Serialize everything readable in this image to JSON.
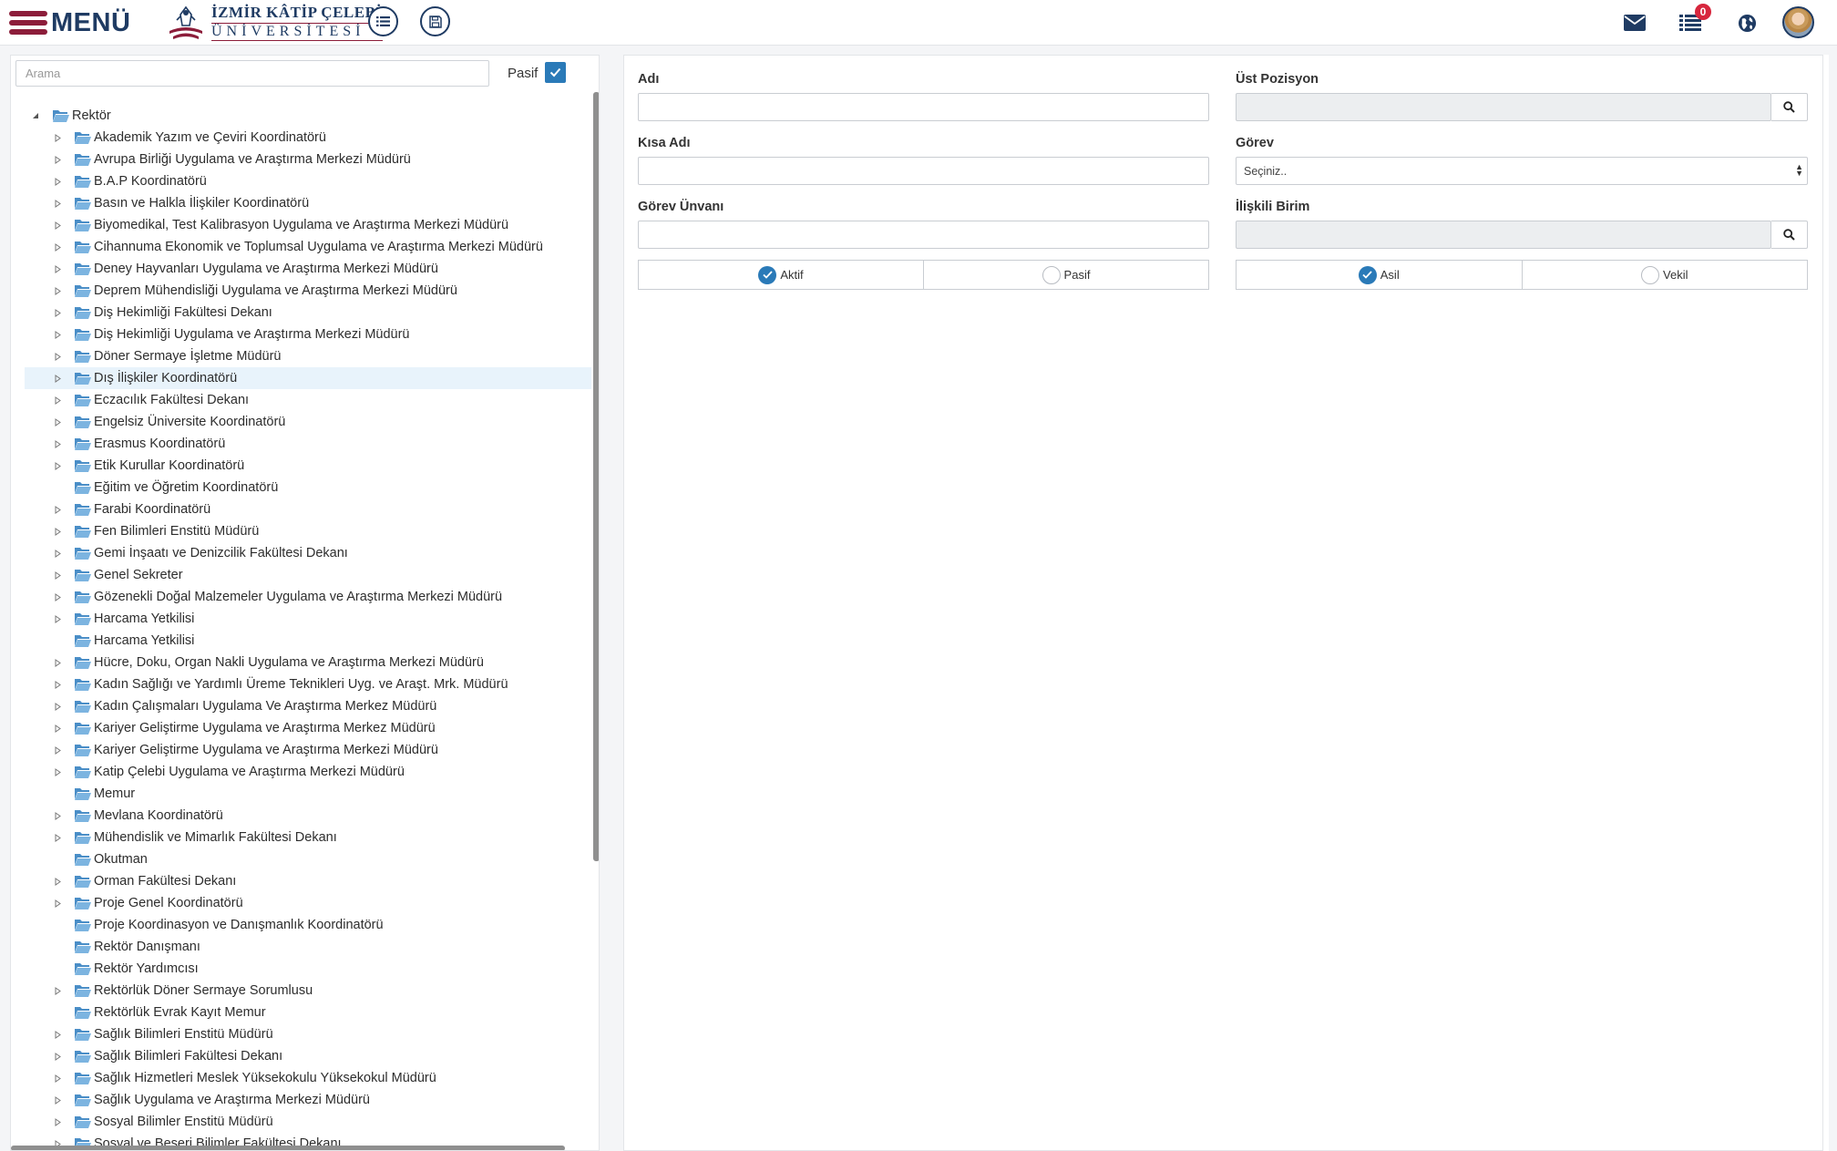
{
  "header": {
    "menu_label": "MENÜ",
    "logo_line1": "İZMİR KÂTİP ÇELEBİ",
    "logo_line2": "ÜNİVERSİTESİ",
    "list_button_icon": "list-icon",
    "save_button_icon": "save-icon",
    "mail_icon": "envelope-icon",
    "tasks_icon": "tasks-list-icon",
    "tasks_badge": "0",
    "language_icon": "globe-icon",
    "accent_color": "#1f3b63",
    "brand_color": "#8c1d3a"
  },
  "left": {
    "search": {
      "placeholder": "Arama",
      "value": ""
    },
    "pasif_label": "Pasif",
    "pasif_checked": true,
    "tree_root": "Rektör",
    "selected_index": 11,
    "items": [
      {
        "label": "Akademik Yazım ve Çeviri Koordinatörü",
        "expandable": true
      },
      {
        "label": "Avrupa Birliği Uygulama ve Araştırma Merkezi Müdürü",
        "expandable": true
      },
      {
        "label": "B.A.P Koordinatörü",
        "expandable": true
      },
      {
        "label": "Basın ve Halkla İlişkiler Koordinatörü",
        "expandable": true
      },
      {
        "label": "Biyomedikal, Test Kalibrasyon Uygulama ve Araştırma Merkezi Müdürü",
        "expandable": true
      },
      {
        "label": "Cihannuma Ekonomik ve Toplumsal Uygulama ve Araştırma Merkezi Müdürü",
        "expandable": true
      },
      {
        "label": "Deney Hayvanları Uygulama ve Araştırma Merkezi Müdürü",
        "expandable": true
      },
      {
        "label": "Deprem Mühendisliği Uygulama ve Araştırma Merkezi Müdürü",
        "expandable": true
      },
      {
        "label": "Diş Hekimliği Fakültesi Dekanı",
        "expandable": true
      },
      {
        "label": "Diş Hekimliği Uygulama ve Araştırma Merkezi Müdürü",
        "expandable": true
      },
      {
        "label": "Döner Sermaye İşletme Müdürü",
        "expandable": true
      },
      {
        "label": "Dış İlişkiler Koordinatörü",
        "expandable": true
      },
      {
        "label": "Eczacılık Fakültesi Dekanı",
        "expandable": true
      },
      {
        "label": "Engelsiz Üniversite Koordinatörü",
        "expandable": true
      },
      {
        "label": "Erasmus Koordinatörü",
        "expandable": true
      },
      {
        "label": "Etik Kurullar Koordinatörü",
        "expandable": true
      },
      {
        "label": "Eğitim ve Öğretim Koordinatörü",
        "expandable": false
      },
      {
        "label": "Farabi Koordinatörü",
        "expandable": true
      },
      {
        "label": "Fen Bilimleri Enstitü Müdürü",
        "expandable": true
      },
      {
        "label": "Gemi İnşaatı ve Denizcilik Fakültesi Dekanı",
        "expandable": true
      },
      {
        "label": "Genel Sekreter",
        "expandable": true
      },
      {
        "label": "Gözenekli Doğal Malzemeler Uygulama ve Araştırma Merkezi Müdürü",
        "expandable": true
      },
      {
        "label": "Harcama Yetkilisi",
        "expandable": true
      },
      {
        "label": "Harcama Yetkilisi",
        "expandable": false
      },
      {
        "label": "Hücre, Doku, Organ Nakli Uygulama ve Araştırma Merkezi Müdürü",
        "expandable": true
      },
      {
        "label": "Kadın Sağlığı ve Yardımlı Üreme Teknikleri Uyg. ve Araşt. Mrk. Müdürü",
        "expandable": true
      },
      {
        "label": "Kadın Çalışmaları Uygulama Ve Araştırma Merkez Müdürü",
        "expandable": true
      },
      {
        "label": "Kariyer Geliştirme Uygulama ve Araştırma Merkez Müdürü",
        "expandable": true
      },
      {
        "label": "Kariyer Geliştirme Uygulama ve Araştırma Merkezi Müdürü",
        "expandable": true
      },
      {
        "label": "Katip Çelebi Uygulama ve Araştırma Merkezi Müdürü",
        "expandable": true
      },
      {
        "label": "Memur",
        "expandable": false
      },
      {
        "label": "Mevlana Koordinatörü",
        "expandable": true
      },
      {
        "label": "Mühendislik ve Mimarlık Fakültesi Dekanı",
        "expandable": true
      },
      {
        "label": "Okutman",
        "expandable": false
      },
      {
        "label": "Orman Fakültesi Dekanı",
        "expandable": true
      },
      {
        "label": "Proje Genel Koordinatörü",
        "expandable": true
      },
      {
        "label": "Proje Koordinasyon ve Danışmanlık Koordinatörü",
        "expandable": false
      },
      {
        "label": "Rektör Danışmanı",
        "expandable": false
      },
      {
        "label": "Rektör Yardımcısı",
        "expandable": false
      },
      {
        "label": "Rektörlük Döner Sermaye Sorumlusu",
        "expandable": true
      },
      {
        "label": "Rektörlük Evrak Kayıt Memur",
        "expandable": false
      },
      {
        "label": "Sağlık Bilimleri Enstitü Müdürü",
        "expandable": true
      },
      {
        "label": "Sağlık Bilimleri Fakültesi Dekanı",
        "expandable": true
      },
      {
        "label": "Sağlık Hizmetleri Meslek Yüksekokulu Yüksekokul Müdürü",
        "expandable": true
      },
      {
        "label": "Sağlık Uygulama ve Araştırma Merkezi Müdürü",
        "expandable": true
      },
      {
        "label": "Sosyal Bilimler Enstitü Müdürü",
        "expandable": true
      },
      {
        "label": "Sosyal ve Beşeri Bilimler Fakültesi Dekanı",
        "expandable": true
      }
    ]
  },
  "form": {
    "adi": {
      "label": "Adı",
      "value": ""
    },
    "ust_pozisyon": {
      "label": "Üst Pozisyon",
      "value": ""
    },
    "kisa_adi": {
      "label": "Kısa Adı",
      "value": ""
    },
    "gorev": {
      "label": "Görev",
      "value": "Seçiniz.."
    },
    "gorev_unvani": {
      "label": "Görev Ünvanı",
      "value": ""
    },
    "iliskili_birim": {
      "label": "İlişkili Birim",
      "value": ""
    },
    "status": {
      "option1": "Aktif",
      "option2": "Pasif",
      "selected": "Aktif"
    },
    "type": {
      "option1": "Asil",
      "option2": "Vekil",
      "selected": "Asil"
    }
  }
}
